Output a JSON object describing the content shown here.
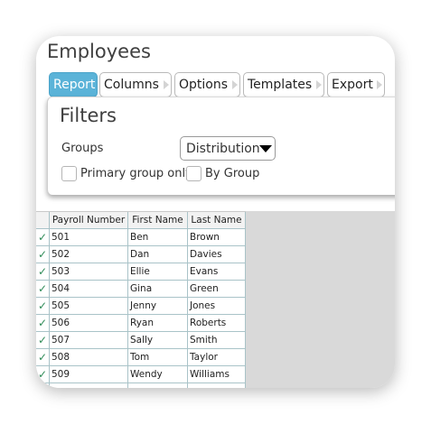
{
  "page": {
    "title": "Employees"
  },
  "tabs": [
    {
      "label": "Report",
      "active": true
    },
    {
      "label": "Columns",
      "active": false
    },
    {
      "label": "Options",
      "active": false
    },
    {
      "label": "Templates",
      "active": false
    },
    {
      "label": "Export",
      "active": false
    }
  ],
  "filters": {
    "title": "Filters",
    "groups_label": "Groups",
    "groups_value": "Distribution",
    "primary_group_only_label": "Primary group only",
    "primary_group_only_checked": false,
    "by_group_label": "By Group",
    "by_group_checked": false
  },
  "table": {
    "columns": [
      "Payroll Number",
      "First Name",
      "Last Name"
    ],
    "check_glyph": "✓",
    "rows": [
      {
        "payroll": "501",
        "first": "Ben",
        "last": "Brown"
      },
      {
        "payroll": "502",
        "first": "Dan",
        "last": "Davies"
      },
      {
        "payroll": "503",
        "first": "Ellie",
        "last": "Evans"
      },
      {
        "payroll": "504",
        "first": "Gina",
        "last": "Green"
      },
      {
        "payroll": "505",
        "first": "Jenny",
        "last": "Jones"
      },
      {
        "payroll": "506",
        "first": "Ryan",
        "last": "Roberts"
      },
      {
        "payroll": "507",
        "first": "Sally",
        "last": "Smith"
      },
      {
        "payroll": "508",
        "first": "Tom",
        "last": "Taylor"
      },
      {
        "payroll": "509",
        "first": "Wendy",
        "last": "Williams"
      }
    ]
  },
  "colors": {
    "active_tab": "#5bb3d8",
    "check": "#2e8b57",
    "grid_line": "#a9c3c8"
  }
}
